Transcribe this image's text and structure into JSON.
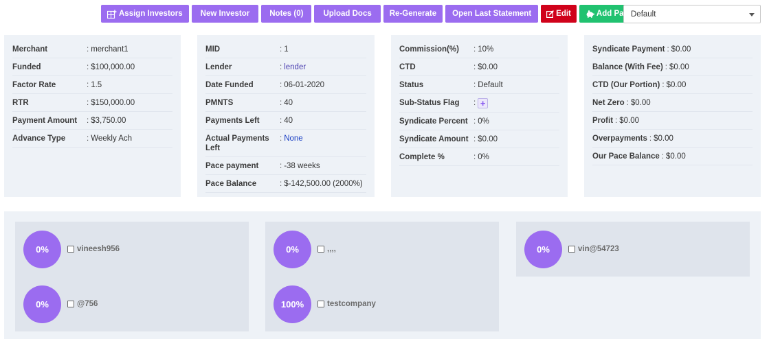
{
  "toolbar": {
    "assign_investors": "Assign Investors",
    "new_investor": "New Investor",
    "notes": "Notes (0)",
    "upload_docs": "Upload Docs",
    "regenerate": "Re-Generate",
    "open_last_statement": "Open Last Statement",
    "edit": "Edit",
    "add_payment": "Add Payment",
    "colors": {
      "purple": "#9b6cf0",
      "red": "#d0021b",
      "green": "#21c270"
    }
  },
  "status_select": {
    "selected": "Default"
  },
  "panel1": [
    {
      "label": "Merchant",
      "value": "merchant1"
    },
    {
      "label": "Funded",
      "value": "$100,000.00"
    },
    {
      "label": "Factor Rate",
      "value": "1.5"
    },
    {
      "label": "RTR",
      "value": "$150,000.00"
    },
    {
      "label": "Payment Amount",
      "value": "$3,750.00"
    },
    {
      "label": "Advance Type",
      "value": "Weekly Ach"
    }
  ],
  "panel2": [
    {
      "label": "MID",
      "value": "1"
    },
    {
      "label": "Lender",
      "value": "lender"
    },
    {
      "label": "Date Funded",
      "value": "06-01-2020"
    },
    {
      "label": "PMNTS",
      "value": "40"
    },
    {
      "label": "Payments Left",
      "value": "40"
    },
    {
      "label": "Actual Payments Left",
      "value": "None"
    },
    {
      "label": "Pace payment",
      "value": "-38 weeks"
    },
    {
      "label": "Pace Balance",
      "value": "$-142,500.00 (2000%)"
    }
  ],
  "panel3": [
    {
      "label": "Commission(%)",
      "value": "10%"
    },
    {
      "label": "CTD",
      "value": "$0.00"
    },
    {
      "label": "Status",
      "value": "Default"
    },
    {
      "label": "Sub-Status Flag",
      "value": "+"
    },
    {
      "label": "Syndicate Percent",
      "value": "0%"
    },
    {
      "label": "Syndicate Amount",
      "value": "$0.00"
    },
    {
      "label": "Complete %",
      "value": "0%"
    }
  ],
  "panel4": [
    {
      "label": "Syndicate Payment",
      "value": "$0.00"
    },
    {
      "label": "Balance (With Fee)",
      "value": "$0.00"
    },
    {
      "label": "CTD (Our Portion)",
      "value": "$0.00"
    },
    {
      "label": "Net Zero",
      "value": "$0.00"
    },
    {
      "label": "Profit",
      "value": "$0.00"
    },
    {
      "label": "Overpayments",
      "value": "$0.00"
    },
    {
      "label": "Our Pace Balance",
      "value": "$0.00"
    }
  ],
  "investors": [
    {
      "percent": "0%",
      "name": "vineesh956"
    },
    {
      "percent": "0%",
      "name": ",,,,"
    },
    {
      "percent": "0%",
      "name": "vin@54723"
    },
    {
      "percent": "0%",
      "name": "@756"
    },
    {
      "percent": "100%",
      "name": "testcompany"
    }
  ]
}
